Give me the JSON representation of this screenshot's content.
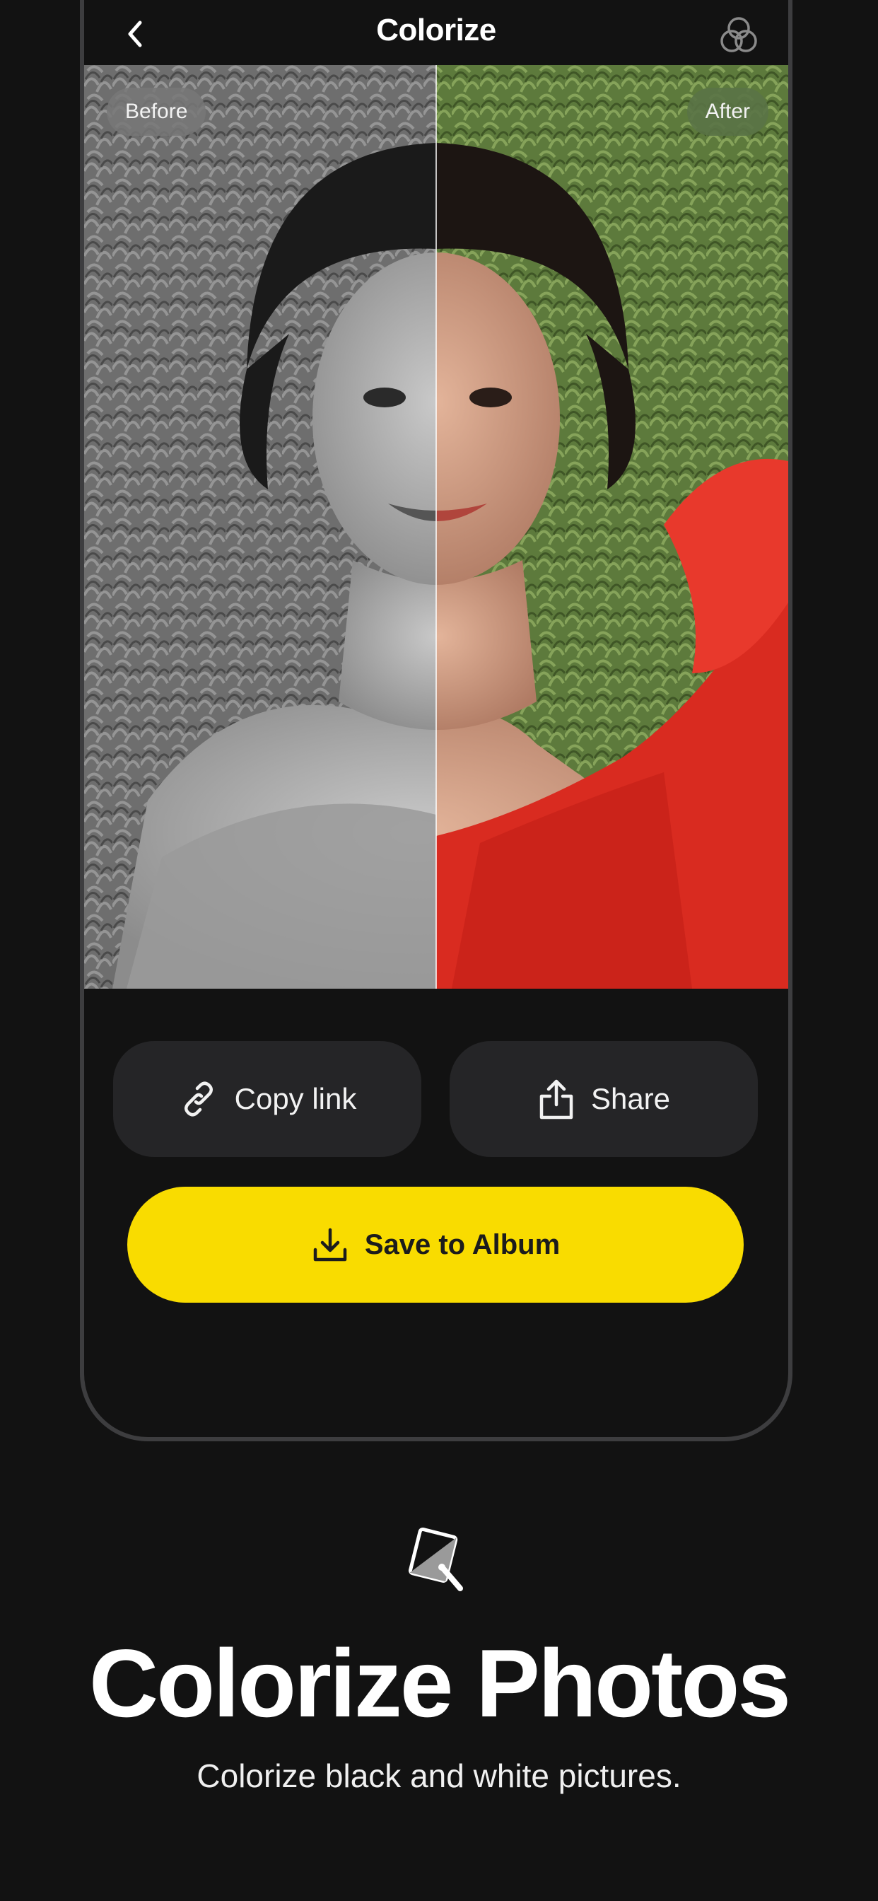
{
  "nav": {
    "title": "Colorize",
    "back_icon": "chevron-left-icon",
    "filters_icon": "overlapping-circles-icon"
  },
  "compare": {
    "before_label": "Before",
    "after_label": "After",
    "split_fraction": 0.5
  },
  "actions": {
    "copy_label": "Copy link",
    "copy_icon": "link-icon",
    "share_label": "Share",
    "share_icon": "share-icon",
    "save_label": "Save to Album",
    "save_icon": "download-icon"
  },
  "feature": {
    "icon": "colorize-brush-icon",
    "title": "Colorize Photos",
    "subtitle": "Colorize black and white pictures."
  },
  "colors": {
    "background": "#121212",
    "accent": "#f9dc00",
    "button_surface": "#252527"
  }
}
